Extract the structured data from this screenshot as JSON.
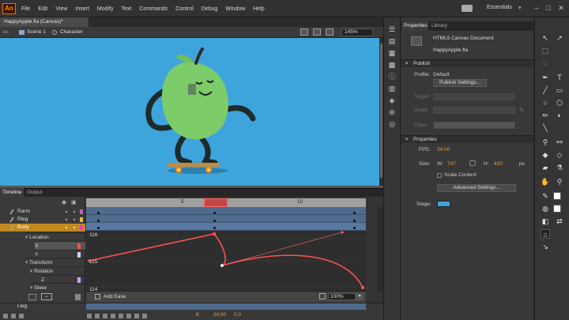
{
  "app": {
    "logo": "An",
    "menu": [
      "File",
      "Edit",
      "View",
      "Insert",
      "Modify",
      "Text",
      "Commands",
      "Control",
      "Debug",
      "Window",
      "Help"
    ],
    "workspace": "Essentials",
    "window_controls": [
      "–",
      "□",
      "✕"
    ]
  },
  "document": {
    "tab": "HappyApple.fla (Canvas)*",
    "scene": "Scene 1",
    "symbol": "Character",
    "zoom": "145%"
  },
  "timeline": {
    "tabs": [
      "Timeline",
      "Output"
    ],
    "layers": [
      {
        "name": "Rarm",
        "color": "#c060c0"
      },
      {
        "name": "Rleg",
        "color": "#e0c040"
      },
      {
        "name": "Body",
        "color": "#e040c0"
      }
    ],
    "properties": [
      {
        "name": "Location"
      },
      {
        "name": "X",
        "color": "#ff5050"
      },
      {
        "name": "Y",
        "color": "#d0d0ff"
      },
      {
        "name": "Transform"
      },
      {
        "name": "Rotation"
      },
      {
        "name": "Z",
        "color": "#d0a0ff"
      },
      {
        "name": "Skew"
      }
    ],
    "bottom_layer": "Lleg",
    "ruler_labels": [
      "5",
      "10"
    ],
    "graph_labels": [
      "116",
      "115",
      "114"
    ],
    "add_ease": "Add Ease",
    "graph_zoom": "100%",
    "current_frame": "8",
    "fps": "24.00",
    "time": "0.3"
  },
  "properties_panel": {
    "tabs": [
      "Properties",
      "Library"
    ],
    "doc_type": "HTML5 Canvas Document",
    "doc_name": "HappyApple.fla",
    "publish": {
      "header": "Publish",
      "profile_label": "Profile:",
      "profile_value": "Default",
      "settings_button": "Publish Settings...",
      "target_label": "Target:",
      "script_label": "Script:",
      "class_label": "Class:"
    },
    "props": {
      "header": "Properties",
      "fps_label": "FPS:",
      "fps_value": "24.00",
      "size_label": "Size:",
      "w_label": "W:",
      "w_value": "747",
      "h_label": "H:",
      "h_value": "420",
      "unit": "px",
      "scale_content": "Scale Content",
      "advanced_button": "Advanced Settings...",
      "stage_label": "Stage:",
      "stage_color": "#3ea4dc"
    }
  },
  "colors": {
    "stage": "#3ea4dc",
    "apple": "#7dcc6a",
    "ease_curve": "#ff5050",
    "frame_blue": "#4e6a8c"
  }
}
